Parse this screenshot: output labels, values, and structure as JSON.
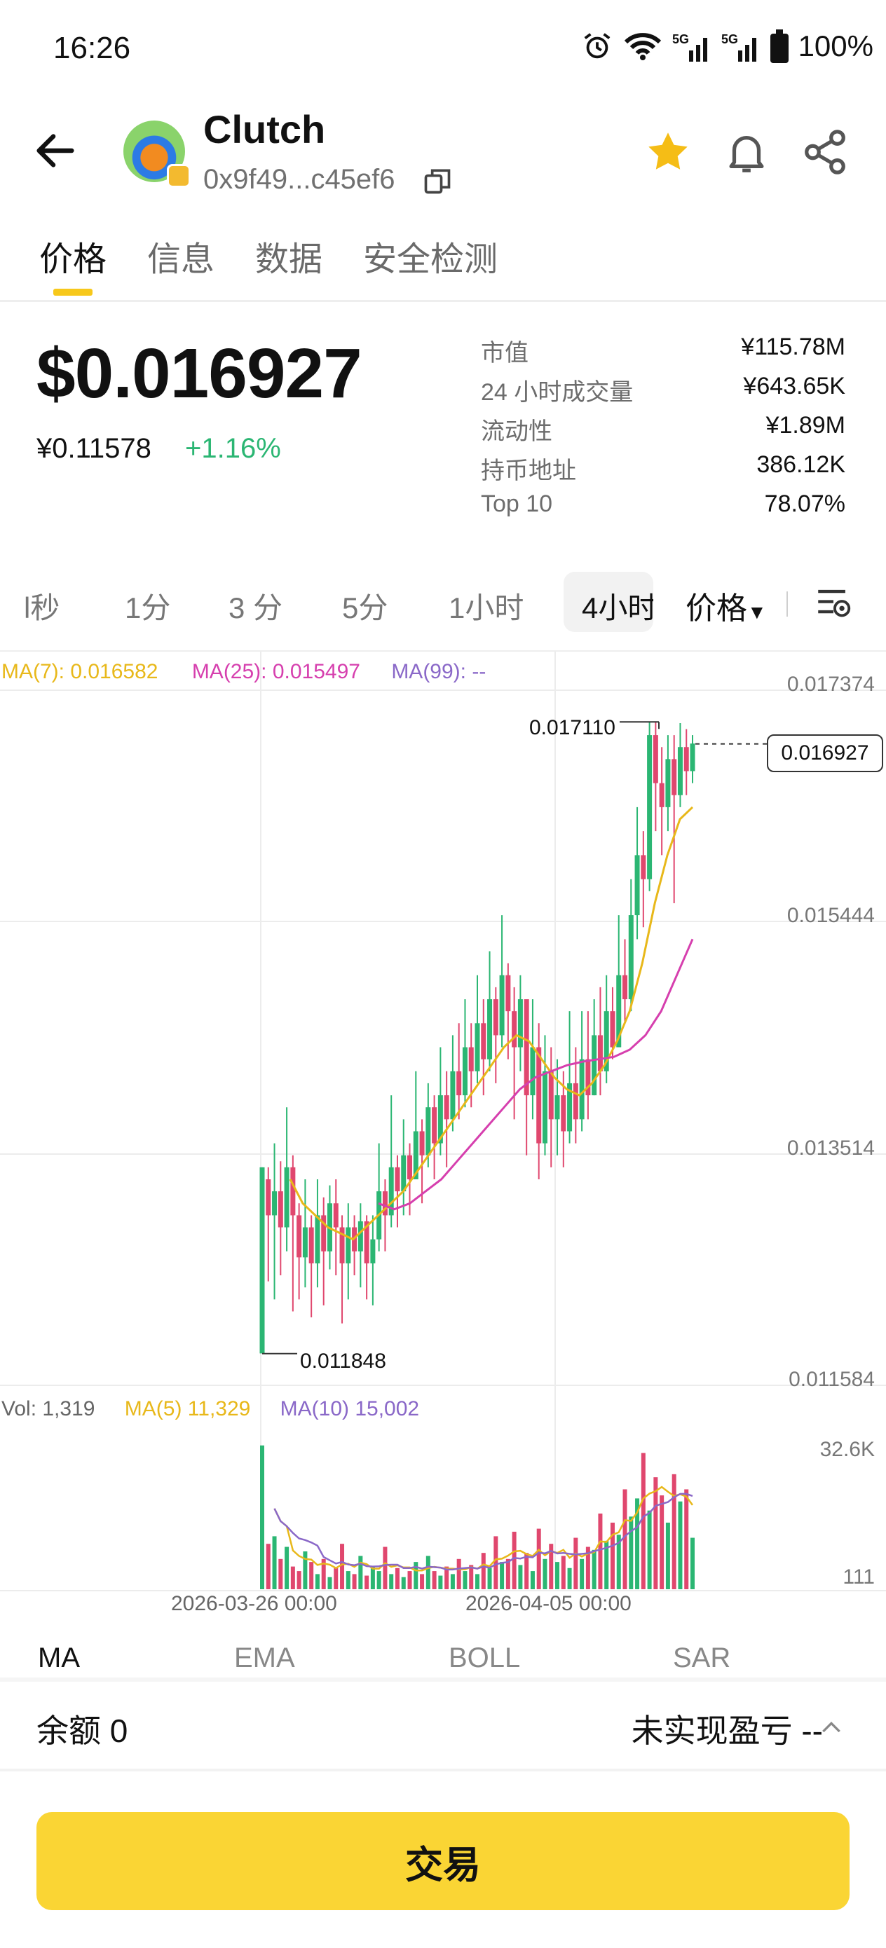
{
  "status_bar": {
    "time": "16:26",
    "battery": "100%",
    "network": "5G"
  },
  "header": {
    "token_name": "Clutch",
    "address": "0x9f49...c45ef6"
  },
  "tabs": [
    "价格",
    "信息",
    "数据",
    "安全检测"
  ],
  "price": {
    "usd": "$0.016927",
    "cny": "¥0.11578",
    "change": "+1.16%"
  },
  "stats": [
    {
      "label": "市值",
      "value": "¥115.78M"
    },
    {
      "label": "24 小时成交量",
      "value": "¥643.65K"
    },
    {
      "label": "流动性",
      "value": "¥1.89M"
    },
    {
      "label": "持币地址",
      "value": "386.12K"
    },
    {
      "label": "Top 10",
      "value": "78.07%"
    }
  ],
  "intervals": [
    "l秒",
    "1分",
    "3 分",
    "5分",
    "1小时",
    "4小时"
  ],
  "interval_active": "4小时",
  "price_dropdown": "价格",
  "chart_data": {
    "type": "candlestick",
    "ma_legend": {
      "ma7": "MA(7): 0.016582",
      "ma25": "MA(25): 0.015497",
      "ma99": "MA(99): --"
    },
    "y_ticks": [
      "0.017374",
      "0.015444",
      "0.013514",
      "0.011584"
    ],
    "ylim": [
      0.011584,
      0.017374
    ],
    "x_ticks": [
      "2026-03-26 00:00",
      "2026-04-05 00:00"
    ],
    "high_label": "0.017110",
    "low_label": "0.011848",
    "current_label": "0.016927",
    "candles": [
      [
        0.01185,
        0.0134,
        0.0134,
        0.01185
      ],
      [
        0.0133,
        0.013,
        0.0134,
        0.01245
      ],
      [
        0.013,
        0.0132,
        0.0136,
        0.0123
      ],
      [
        0.0132,
        0.0129,
        0.01345,
        0.0125
      ],
      [
        0.0129,
        0.0134,
        0.0139,
        0.0127
      ],
      [
        0.0134,
        0.013,
        0.0135,
        0.0122
      ],
      [
        0.013,
        0.01265,
        0.0131,
        0.0123
      ],
      [
        0.01265,
        0.0129,
        0.0133,
        0.0124
      ],
      [
        0.0129,
        0.0126,
        0.013,
        0.01215
      ],
      [
        0.0126,
        0.013,
        0.0133,
        0.0124
      ],
      [
        0.013,
        0.0127,
        0.01315,
        0.01225
      ],
      [
        0.0127,
        0.0131,
        0.01325,
        0.01255
      ],
      [
        0.0131,
        0.0129,
        0.0133,
        0.0125
      ],
      [
        0.0129,
        0.0126,
        0.013,
        0.0121
      ],
      [
        0.0126,
        0.0129,
        0.0131,
        0.0123
      ],
      [
        0.0129,
        0.0127,
        0.013,
        0.0125
      ],
      [
        0.0127,
        0.01295,
        0.0131,
        0.0124
      ],
      [
        0.01295,
        0.0126,
        0.013,
        0.0123
      ],
      [
        0.0126,
        0.0128,
        0.013,
        0.01225
      ],
      [
        0.0128,
        0.0132,
        0.0136,
        0.0127
      ],
      [
        0.0132,
        0.013,
        0.0133,
        0.0127
      ],
      [
        0.013,
        0.0134,
        0.014,
        0.0129
      ],
      [
        0.0134,
        0.0132,
        0.0135,
        0.0129
      ],
      [
        0.0132,
        0.0135,
        0.0138,
        0.013
      ],
      [
        0.0135,
        0.0133,
        0.0136,
        0.013
      ],
      [
        0.0133,
        0.0137,
        0.0142,
        0.0133
      ],
      [
        0.0137,
        0.0135,
        0.0138,
        0.0131
      ],
      [
        0.0135,
        0.0139,
        0.0141,
        0.0134
      ],
      [
        0.0139,
        0.0136,
        0.014,
        0.0133
      ],
      [
        0.0136,
        0.014,
        0.0144,
        0.0135
      ],
      [
        0.014,
        0.0138,
        0.0142,
        0.0134
      ],
      [
        0.0138,
        0.0142,
        0.0145,
        0.0137
      ],
      [
        0.0142,
        0.014,
        0.0146,
        0.0138
      ],
      [
        0.014,
        0.0144,
        0.0148,
        0.0139
      ],
      [
        0.0144,
        0.0142,
        0.0146,
        0.0139
      ],
      [
        0.0142,
        0.0146,
        0.015,
        0.0141
      ],
      [
        0.0146,
        0.0143,
        0.0148,
        0.014
      ],
      [
        0.0143,
        0.0148,
        0.0152,
        0.0142
      ],
      [
        0.0148,
        0.0145,
        0.0149,
        0.0141
      ],
      [
        0.0145,
        0.015,
        0.0155,
        0.0144
      ],
      [
        0.015,
        0.0147,
        0.0151,
        0.0143
      ],
      [
        0.0147,
        0.0144,
        0.0149,
        0.0138
      ],
      [
        0.0144,
        0.0148,
        0.015,
        0.0142
      ],
      [
        0.0148,
        0.014,
        0.0148,
        0.0135
      ],
      [
        0.014,
        0.0144,
        0.0148,
        0.0138
      ],
      [
        0.0144,
        0.0136,
        0.0146,
        0.0133
      ],
      [
        0.0136,
        0.0142,
        0.0145,
        0.0135
      ],
      [
        0.0142,
        0.0138,
        0.0144,
        0.0134
      ],
      [
        0.0138,
        0.014,
        0.0143,
        0.0135
      ],
      [
        0.014,
        0.0137,
        0.0142,
        0.0134
      ],
      [
        0.0137,
        0.0141,
        0.0147,
        0.0136
      ],
      [
        0.0141,
        0.0138,
        0.0144,
        0.0136
      ],
      [
        0.0138,
        0.0143,
        0.0147,
        0.0137
      ],
      [
        0.0143,
        0.014,
        0.0147,
        0.0138
      ],
      [
        0.014,
        0.0145,
        0.0148,
        0.014
      ],
      [
        0.0145,
        0.0142,
        0.0149,
        0.014
      ],
      [
        0.0142,
        0.0147,
        0.015,
        0.0141
      ],
      [
        0.0147,
        0.0144,
        0.0149,
        0.0143
      ],
      [
        0.0144,
        0.015,
        0.0155,
        0.0144
      ],
      [
        0.015,
        0.0148,
        0.0153,
        0.0146
      ],
      [
        0.0148,
        0.0155,
        0.0158,
        0.0147
      ],
      [
        0.0155,
        0.016,
        0.0164,
        0.0153
      ],
      [
        0.016,
        0.0158,
        0.0162,
        0.0154
      ],
      [
        0.0158,
        0.017,
        0.01711,
        0.0157
      ],
      [
        0.017,
        0.0166,
        0.01711,
        0.0162
      ],
      [
        0.0166,
        0.0164,
        0.0169,
        0.016
      ],
      [
        0.0164,
        0.0168,
        0.017,
        0.0162
      ],
      [
        0.0168,
        0.0165,
        0.017,
        0.0156
      ],
      [
        0.0165,
        0.0169,
        0.0171,
        0.0164
      ],
      [
        0.0169,
        0.0167,
        0.01705,
        0.0165
      ],
      [
        0.0167,
        0.01693,
        0.017,
        0.0166
      ]
    ],
    "ma7": [
      0.0133,
      0.0131,
      0.013,
      0.0129,
      0.01285,
      0.0128,
      0.0129,
      0.013,
      0.0131,
      0.0132,
      0.01335,
      0.0135,
      0.01365,
      0.0138,
      0.01395,
      0.0141,
      0.01425,
      0.0144,
      0.0145,
      0.01445,
      0.0143,
      0.01415,
      0.01405,
      0.014,
      0.0141,
      0.01425,
      0.01445,
      0.0147,
      0.0151,
      0.0156,
      0.016,
      0.0163,
      0.0164
    ],
    "ma25": [
      0.0131,
      0.01305,
      0.0131,
      0.0132,
      0.0133,
      0.01345,
      0.0136,
      0.01375,
      0.0139,
      0.01405,
      0.01415,
      0.0142,
      0.01425,
      0.01428,
      0.0143,
      0.01432,
      0.01438,
      0.0145,
      0.0147,
      0.015,
      0.0153
    ],
    "volume": {
      "legend": {
        "vol": "Vol: 1,319",
        "ma5": "MA(5) 11,329",
        "ma10": "MA(10) 15,002"
      },
      "y_ticks": [
        "32.6K",
        "111"
      ]
    }
  },
  "indicators": [
    "MA",
    "EMA",
    "BOLL",
    "SAR"
  ],
  "indicator_active": "MA",
  "balance": {
    "label": "余额 0",
    "pnl_label": "未实现盈亏 --"
  },
  "trade_button": "交易",
  "colors": {
    "up": "#2bb673",
    "down": "#e0476e",
    "ma7": "#e8b81a",
    "ma25": "#d63fae",
    "ma99": "#8a68c8",
    "accent": "#f7c81b"
  }
}
